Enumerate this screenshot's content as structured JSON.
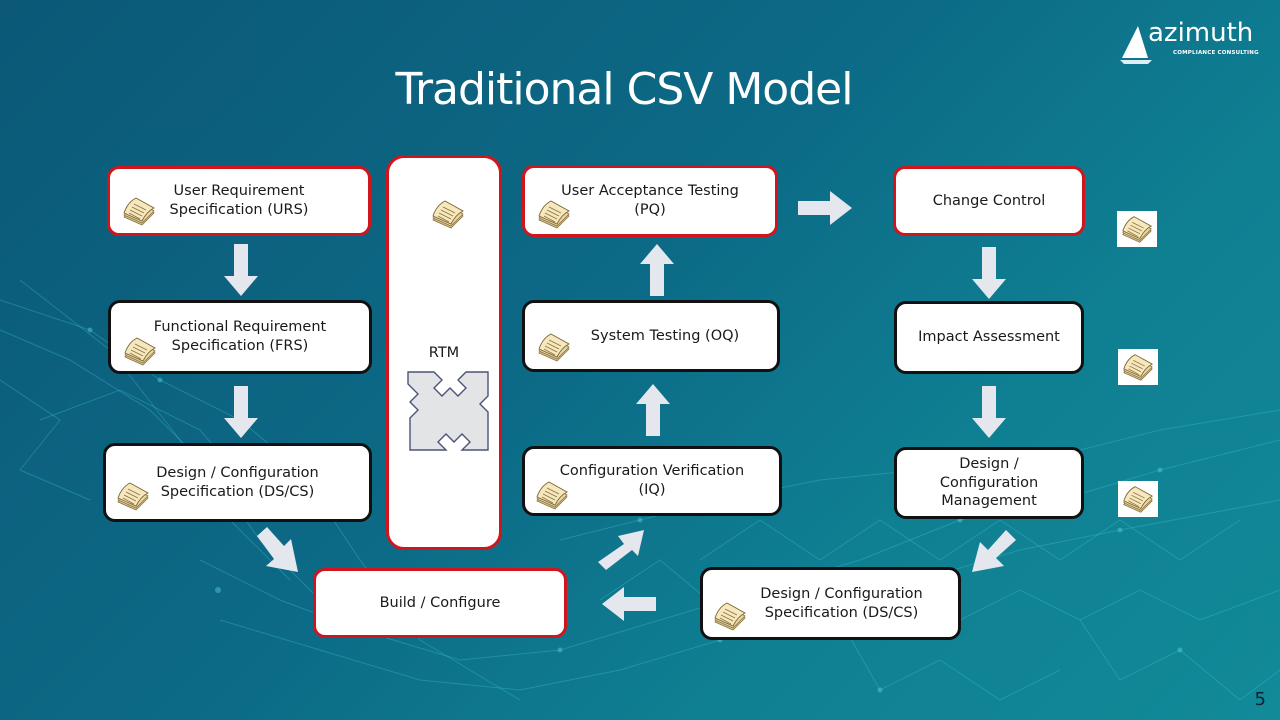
{
  "slide": {
    "title": "Traditional CSV Model",
    "page_number": "5"
  },
  "logo": {
    "name": "azimuth",
    "tagline": "COMPLIANCE CONSULTING"
  },
  "colors": {
    "red_border": "#d0161c",
    "black_border": "#111111",
    "arrow_fill": "#e4e7ed",
    "background": "#0c6a86"
  },
  "boxes": {
    "urs": "User Requirement\nSpecification (URS)",
    "frs": "Functional Requirement\nSpecification (FRS)",
    "dscs_left": "Design / Configuration\nSpecification (DS/CS)",
    "rtm": "RTM",
    "uat": "User Acceptance Testing\n(PQ)",
    "oq": "System Testing (OQ)",
    "iq": "Configuration Verification\n(IQ)",
    "build": "Build / Configure",
    "change_control": "Change Control",
    "impact": "Impact Assessment",
    "dcm": "Design /\nConfiguration\nManagement",
    "dscs_bottom": "Design / Configuration\nSpecification (DS/CS)"
  },
  "icons": {
    "document": "document-stack-icon",
    "rtm": "expand-arrows-icon",
    "arrow": "block-arrow-icon"
  }
}
